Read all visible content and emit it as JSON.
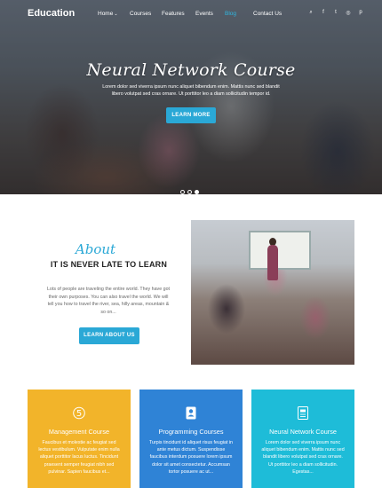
{
  "nav": {
    "logo": "Education",
    "items": [
      {
        "label": "Home",
        "active": false,
        "has_dropdown": true
      },
      {
        "label": "Courses",
        "active": false
      },
      {
        "label": "Features",
        "active": false
      },
      {
        "label": "Events",
        "active": false
      },
      {
        "label": "Blog",
        "active": true
      },
      {
        "label": "Contact Us",
        "active": false
      }
    ],
    "social": [
      "search-icon",
      "facebook-icon",
      "twitter-icon",
      "instagram-icon",
      "pinterest-icon"
    ],
    "social_glyphs": [
      "⌕",
      "f",
      "t",
      "◎",
      "p"
    ]
  },
  "hero": {
    "title": "Neural Network Course",
    "text": "Lorem dolor sed viverra ipsum nunc aliquet bibendum enim. Mattis nunc sed blandit libero volutpat sed cras ornare. Ut porttitor leo a diam sollicitudin tempor id.",
    "button": "LEARN MORE",
    "slides": 3,
    "active_slide": 3
  },
  "about": {
    "script_title": "About",
    "heading": "IT IS NEVER LATE TO LEARN",
    "text": "Lots of people are traveling the entire world. They have got their own purposes. You can also travel the world. We will tell you how to travel the river, sea, hilly areas, mountain & so on...",
    "button": "LEARN ABOUT US"
  },
  "cards": [
    {
      "title": "Management Course",
      "text": "Faucibus et molestie ac feugiat sed lectus vestibulum. Vulputate enim nulla aliquet porttitor lacus luctus. Tincidunt praesent semper feugiat nibh sed pulvinar. Sapien faucibus et...",
      "icon": "five-icon",
      "color": "#f2b42a"
    },
    {
      "title": "Programming Courses",
      "text": "Turpis tincidunt id aliquet risus feugiat in ante metus dictum. Suspendisse faucibus interdum posuere lorem ipsum dolor sit amet consectetur. Accumsan tortor posuere ac ut...",
      "icon": "contact-book-icon",
      "color": "#2f83d6"
    },
    {
      "title": "Neural Network Course",
      "text": "Lorem dolor sed viverra ipsum nunc aliquet bibendum enim. Mattis nunc sed blandit libero volutpat sed cras ornare. Ut porttitor leo a diam sollicitudin. Egestas...",
      "icon": "document-icon",
      "color": "#1ebcd8"
    }
  ],
  "colors": {
    "accent": "#2aa8d6"
  }
}
